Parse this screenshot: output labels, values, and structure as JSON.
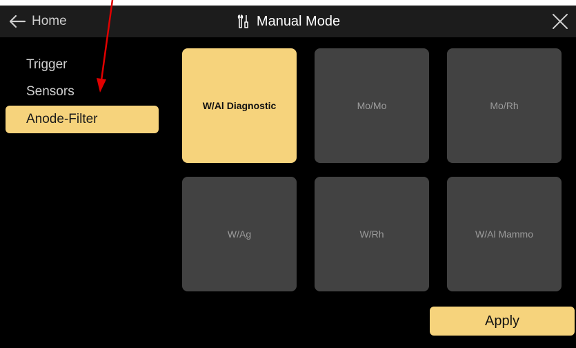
{
  "header": {
    "back_label": "Home",
    "title": "Manual Mode"
  },
  "sidebar": {
    "items": [
      {
        "label": "Trigger"
      },
      {
        "label": "Sensors"
      },
      {
        "label": "Anode-Filter",
        "active": true
      }
    ]
  },
  "grid": {
    "tiles": [
      {
        "label": "W/Al Diagnostic",
        "selected": true
      },
      {
        "label": "Mo/Mo"
      },
      {
        "label": "Mo/Rh"
      },
      {
        "label": "W/Ag"
      },
      {
        "label": "W/Rh"
      },
      {
        "label": "W/Al Mammo"
      }
    ]
  },
  "footer": {
    "apply_label": "Apply"
  },
  "colors": {
    "accent": "#f6d37c",
    "tile": "#424242",
    "annotation_arrow": "#e00000"
  },
  "icons": {
    "back": "arrow-left-icon",
    "title": "tools-icon",
    "close": "close-icon"
  }
}
